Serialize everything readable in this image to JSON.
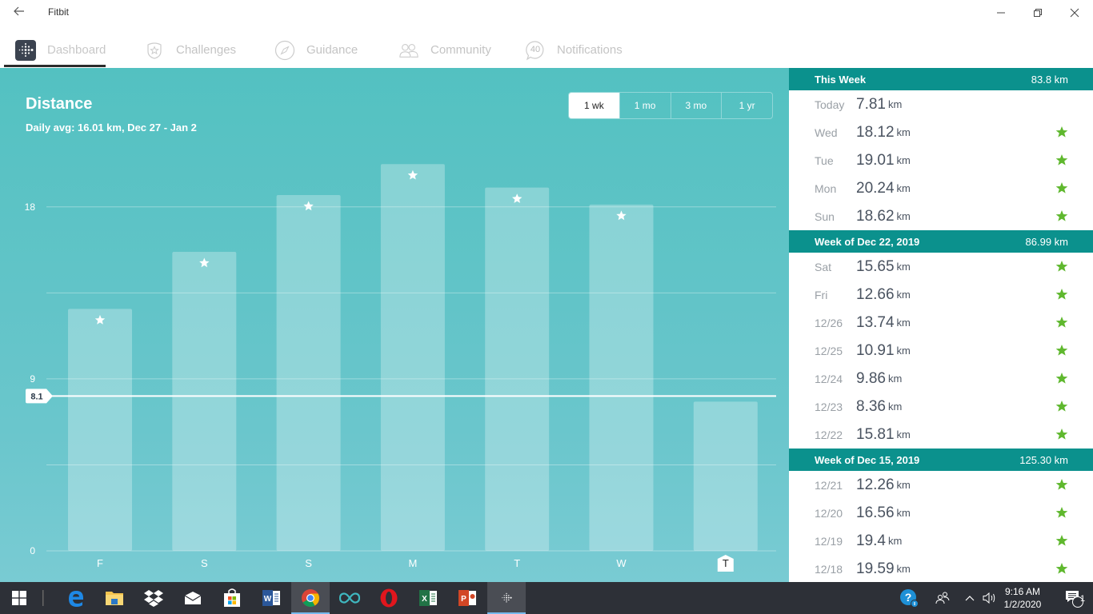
{
  "window": {
    "title": "Fitbit",
    "controls": [
      "minimize",
      "restore",
      "close"
    ]
  },
  "nav": {
    "tabs": [
      {
        "label": "Dashboard",
        "icon": "fitbit-logo-icon",
        "active": true
      },
      {
        "label": "Challenges",
        "icon": "star-badge-icon",
        "active": false
      },
      {
        "label": "Guidance",
        "icon": "compass-icon",
        "active": false
      },
      {
        "label": "Community",
        "icon": "people-icon",
        "active": false
      },
      {
        "label": "Notifications",
        "icon": "notification-bubble-icon",
        "badge": "40",
        "active": false
      }
    ]
  },
  "chart_panel": {
    "title": "Distance",
    "subtitle": "Daily avg: 16.01 km, Dec 27 - Jan 2",
    "ranges": [
      {
        "label": "1 wk",
        "active": true
      },
      {
        "label": "1 mo",
        "active": false
      },
      {
        "label": "3 mo",
        "active": false
      },
      {
        "label": "1 yr",
        "active": false
      }
    ]
  },
  "chart_data": {
    "type": "bar",
    "title": "Distance",
    "subtitle": "Daily avg: 16.01 km, Dec 27 - Jan 2",
    "categories": [
      "F",
      "S",
      "S",
      "M",
      "T",
      "W",
      "T"
    ],
    "values": [
      12.66,
      15.65,
      18.62,
      20.24,
      19.01,
      18.12,
      7.81
    ],
    "goal_met": [
      true,
      true,
      true,
      true,
      true,
      true,
      false
    ],
    "highlighted_category_index": 6,
    "goal_line": {
      "value": 8.1,
      "label": "8.1"
    },
    "yticks": [
      0,
      9,
      18
    ],
    "ylim": [
      0,
      22.5
    ],
    "unit": "km",
    "xlabel": "",
    "ylabel": "",
    "grid": true
  },
  "sidebar": {
    "weeks": [
      {
        "title": "This Week",
        "total": "83.8 km",
        "days": [
          {
            "label": "Today",
            "value": "7.81",
            "unit": "km",
            "goal_met": false
          },
          {
            "label": "Wed",
            "value": "18.12",
            "unit": "km",
            "goal_met": true
          },
          {
            "label": "Tue",
            "value": "19.01",
            "unit": "km",
            "goal_met": true
          },
          {
            "label": "Mon",
            "value": "20.24",
            "unit": "km",
            "goal_met": true
          },
          {
            "label": "Sun",
            "value": "18.62",
            "unit": "km",
            "goal_met": true
          }
        ]
      },
      {
        "title": "Week of Dec 22, 2019",
        "total": "86.99 km",
        "days": [
          {
            "label": "Sat",
            "value": "15.65",
            "unit": "km",
            "goal_met": true
          },
          {
            "label": "Fri",
            "value": "12.66",
            "unit": "km",
            "goal_met": true
          },
          {
            "label": "12/26",
            "value": "13.74",
            "unit": "km",
            "goal_met": true
          },
          {
            "label": "12/25",
            "value": "10.91",
            "unit": "km",
            "goal_met": true
          },
          {
            "label": "12/24",
            "value": "9.86",
            "unit": "km",
            "goal_met": true
          },
          {
            "label": "12/23",
            "value": "8.36",
            "unit": "km",
            "goal_met": true
          },
          {
            "label": "12/22",
            "value": "15.81",
            "unit": "km",
            "goal_met": true
          }
        ]
      },
      {
        "title": "Week of Dec 15, 2019",
        "total": "125.30 km",
        "days": [
          {
            "label": "12/21",
            "value": "12.26",
            "unit": "km",
            "goal_met": true
          },
          {
            "label": "12/20",
            "value": "16.56",
            "unit": "km",
            "goal_met": true
          },
          {
            "label": "12/19",
            "value": "19.4",
            "unit": "km",
            "goal_met": true
          },
          {
            "label": "12/18",
            "value": "19.59",
            "unit": "km",
            "goal_met": true
          }
        ]
      }
    ]
  },
  "colors": {
    "teal_header": "#0b918d",
    "chart_bg": "#53c1c1",
    "star_green": "#5fb82e"
  },
  "taskbar": {
    "apps": [
      "start",
      "task-view",
      "edge",
      "file-explorer",
      "dropbox",
      "mail",
      "store",
      "word",
      "chrome",
      "infinity-app",
      "opera",
      "excel",
      "powerpoint",
      "fitbit"
    ],
    "tray": {
      "time": "9:16 AM",
      "date": "1/2/2020",
      "notification_count": "1"
    }
  }
}
